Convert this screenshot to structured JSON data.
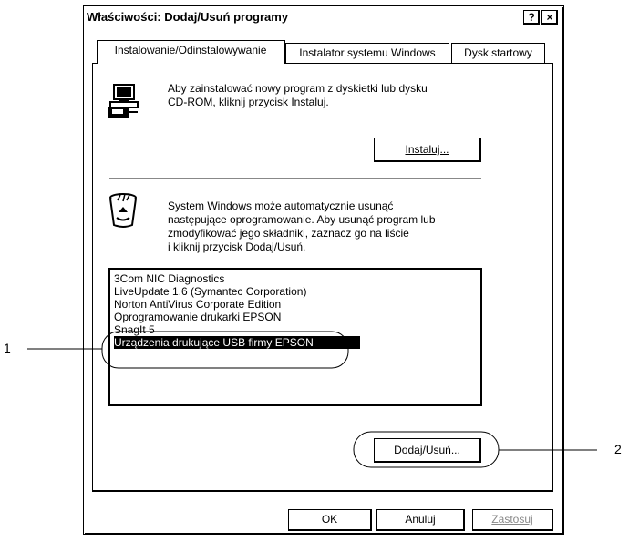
{
  "window": {
    "title": "Właściwości: Dodaj/Usuń programy",
    "help_button": "?",
    "close_button": "×"
  },
  "tabs": [
    {
      "label": "Instalowanie/Odinstalowywanie",
      "active": true
    },
    {
      "label": "Instalator systemu Windows",
      "active": false
    },
    {
      "label": "Dysk startowy",
      "active": false
    }
  ],
  "install_section": {
    "line1": "Aby zainstalować nowy program z dyskietki lub dysku",
    "line2": "CD-ROM, kliknij przycisk Instaluj.",
    "install_button": "Instaluj..."
  },
  "remove_section": {
    "line1": "System Windows może automatycznie usunąć",
    "line2": "następujące oprogramowanie. Aby usunąć program lub",
    "line3": "zmodyfikować jego składniki, zaznacz go na liście",
    "line4": "i kliknij przycisk Dodaj/Usuń."
  },
  "programs": [
    {
      "name": "3Com NIC Diagnostics",
      "selected": false
    },
    {
      "name": "LiveUpdate 1.6 (Symantec Corporation)",
      "selected": false
    },
    {
      "name": "Norton AntiVirus Corporate Edition",
      "selected": false
    },
    {
      "name": "Oprogramowanie drukarki EPSON",
      "selected": false
    },
    {
      "name": "SnagIt 5",
      "selected": false
    },
    {
      "name": "Urządzenia drukujące USB firmy EPSON",
      "selected": true
    }
  ],
  "add_remove_button": "Dodaj/Usuń...",
  "footer": {
    "ok": "OK",
    "cancel": "Anuluj",
    "apply": "Zastosuj"
  },
  "callouts": {
    "one": "1",
    "two": "2"
  },
  "icons": {
    "install": "computer-install-icon",
    "remove": "recycle-bin-icon"
  }
}
